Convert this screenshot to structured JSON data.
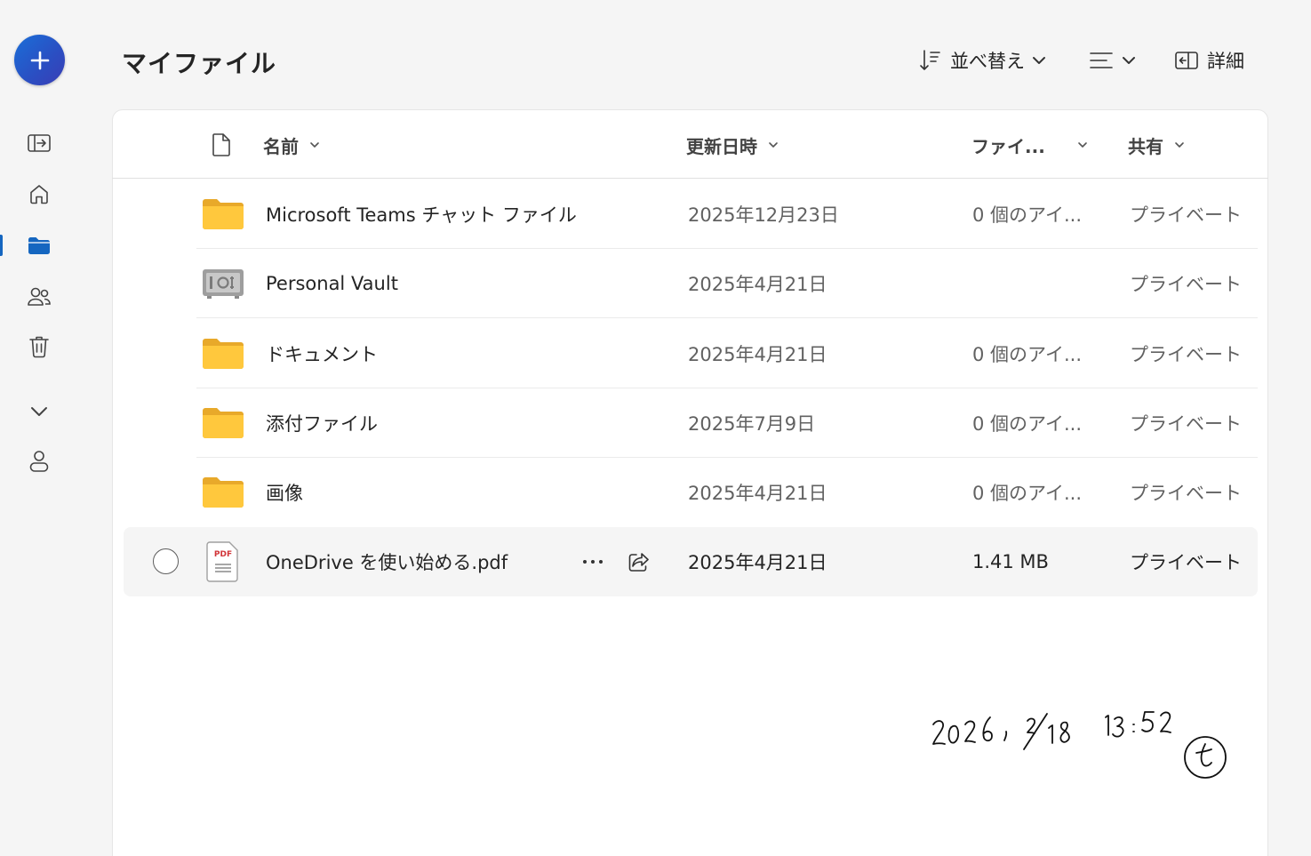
{
  "header": {
    "title": "マイファイル",
    "sort_label": "並べ替え",
    "details_label": "詳細"
  },
  "columns": {
    "name": "名前",
    "modified": "更新日時",
    "size": "ファイ...",
    "sharing": "共有"
  },
  "rows": [
    {
      "type": "folder",
      "name": "Microsoft Teams チャット ファイル",
      "modified": "2025年12月23日",
      "size": "0 個のアイ...",
      "sharing": "プライベート"
    },
    {
      "type": "vault",
      "name": "Personal Vault",
      "modified": "2025年4月21日",
      "size": "",
      "sharing": "プライベート"
    },
    {
      "type": "folder",
      "name": "ドキュメント",
      "modified": "2025年4月21日",
      "size": "0 個のアイ...",
      "sharing": "プライベート"
    },
    {
      "type": "folder",
      "name": "添付ファイル",
      "modified": "2025年7月9日",
      "size": "0 個のアイ...",
      "sharing": "プライベート"
    },
    {
      "type": "folder",
      "name": "画像",
      "modified": "2025年4月21日",
      "size": "0 個のアイ...",
      "sharing": "プライベート"
    },
    {
      "type": "pdf",
      "name": "OneDrive を使い始める.pdf",
      "modified": "2025年4月21日",
      "size": "1.41 MB",
      "sharing": "プライベート"
    }
  ],
  "pdf_badge": "PDF",
  "handwritten_note": "2026 , 2/18 13:52 (t)",
  "colors": {
    "accent": "#1566c0",
    "folder": "#ffc83d",
    "folder_back": "#e8a92a"
  }
}
